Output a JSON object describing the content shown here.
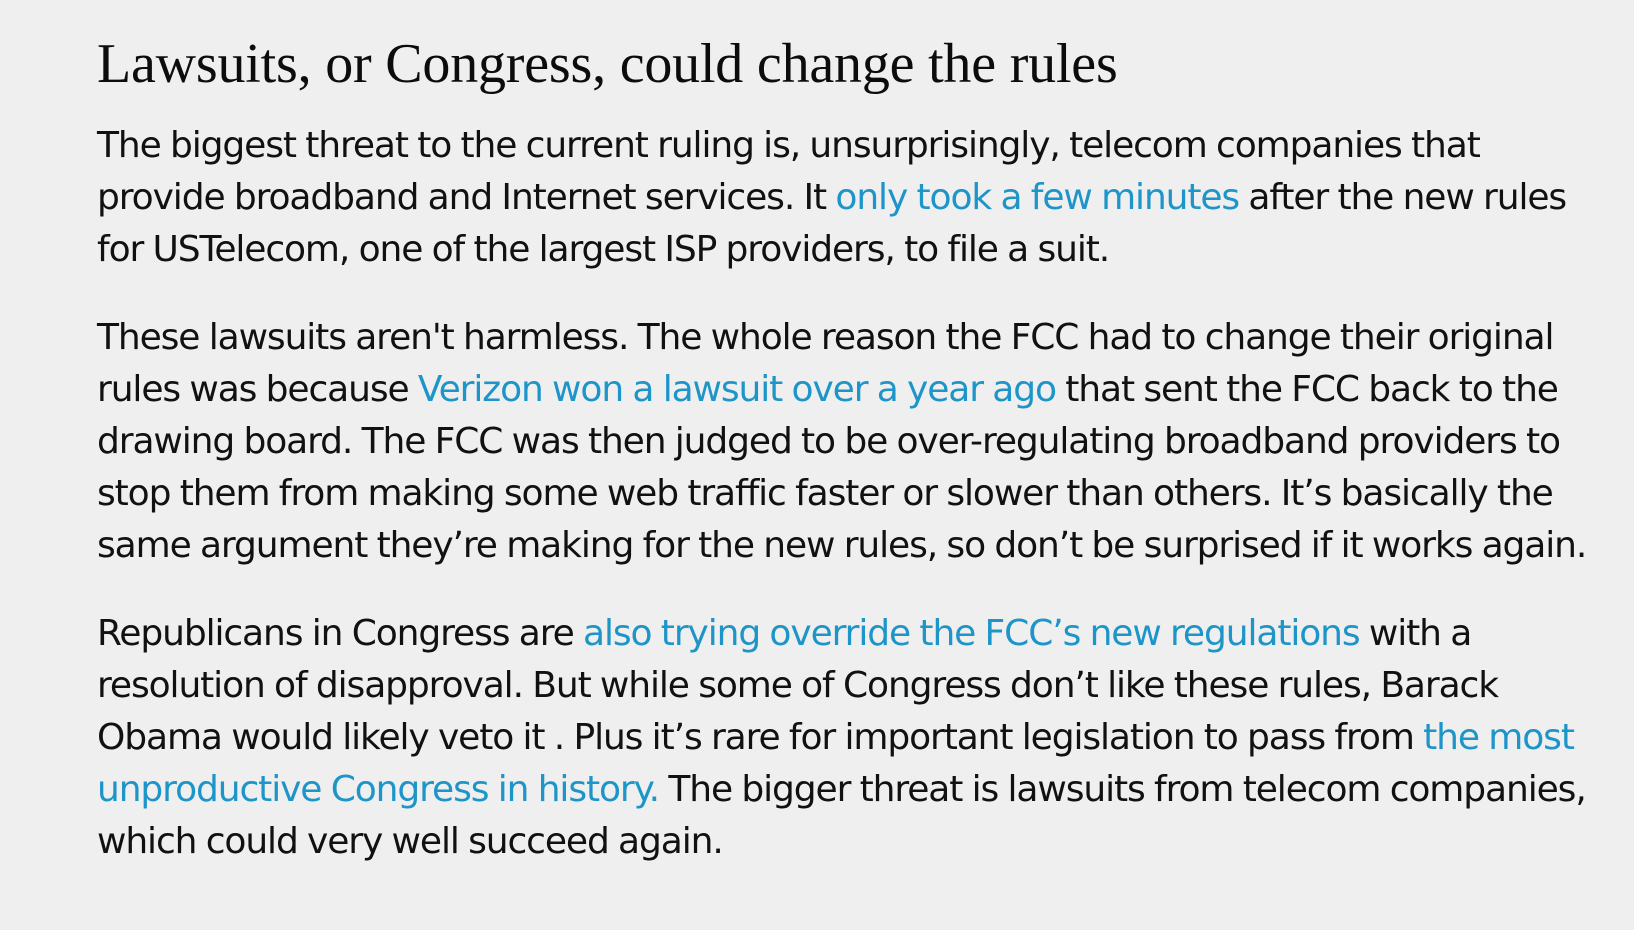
{
  "article": {
    "heading": "Lawsuits, or Congress, could change the rules",
    "paragraphs": [
      {
        "text_1": "The biggest threat to the current ruling is, unsurprisingly, telecom companies that provide broadband and Internet services. It ",
        "link_1": "only took a few minutes",
        "text_2": " after the new rules for USTelecom, one of the largest ISP providers, to file a suit."
      },
      {
        "text_1": "These lawsuits aren't harmless. The whole reason the FCC had to change their original rules was because ",
        "link_1": "Verizon won a lawsuit over a year ago",
        "text_2": " that sent the FCC back to the drawing board. The FCC was then judged to be over-regulating broadband providers to stop them from making some web traffic faster or slower than others. It’s basically the same argument they’re making for the new rules, so don’t be surprised if it works again."
      },
      {
        "text_1": "Republicans in Congress are ",
        "link_1": "also trying override the FCC’s new regulations",
        "text_2": " with a resolution of disapproval. But while some of Congress don’t like these rules, Barack Obama would likely veto it . Plus it’s rare for important legislation to pass from ",
        "link_2": "the most unproductive Congress in history.",
        "text_3": " The bigger threat is lawsuits from telecom companies, which could very well succeed again."
      }
    ]
  },
  "colors": {
    "background": "#efefef",
    "text": "#111111",
    "link": "#1d95c8"
  }
}
